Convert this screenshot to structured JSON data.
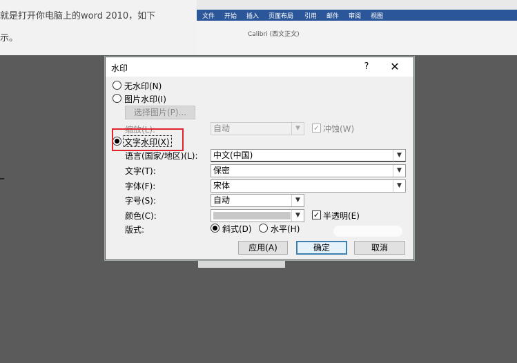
{
  "article": {
    "line1": "就是打开你电脑上的word 2010，如下",
    "line2": "示。"
  },
  "word_ribbon": {
    "tabs": [
      "文件",
      "开始",
      "插入",
      "页面布局",
      "引用",
      "邮件",
      "审阅",
      "视图"
    ],
    "font_box": "Calibri (西文正文)"
  },
  "dialog": {
    "title": "水印",
    "help": "?",
    "close": "✕",
    "no_watermark": "无水印(N)",
    "picture_watermark": "图片水印(I)",
    "select_picture": "选择图片(P)...",
    "scale_label": "缩放(L):",
    "scale_value": "自动",
    "washout_label": "冲蚀(W)",
    "text_watermark": "文字水印(X)",
    "language_label": "语言(国家/地区)(L):",
    "language_value": "中文(中国)",
    "text_label": "文字(T):",
    "text_value": "保密",
    "font_label": "字体(F):",
    "font_value": "宋体",
    "size_label": "字号(S):",
    "size_value": "自动",
    "color_label": "颜色(C):",
    "semitransparent_label": "半透明(E)",
    "layout_label": "版式:",
    "diagonal_label": "斜式(D)",
    "horizontal_label": "水平(H)",
    "apply_button": "应用(A)",
    "ok_button": "确定",
    "cancel_button": "取消"
  },
  "state": {
    "selected_watermark": "text",
    "semitransparent": true,
    "washout": true,
    "layout": "diagonal"
  },
  "colors": {
    "highlight": "#e0232d",
    "default_button_border": "#3c7fb1",
    "ribbon": "#2b579a"
  }
}
